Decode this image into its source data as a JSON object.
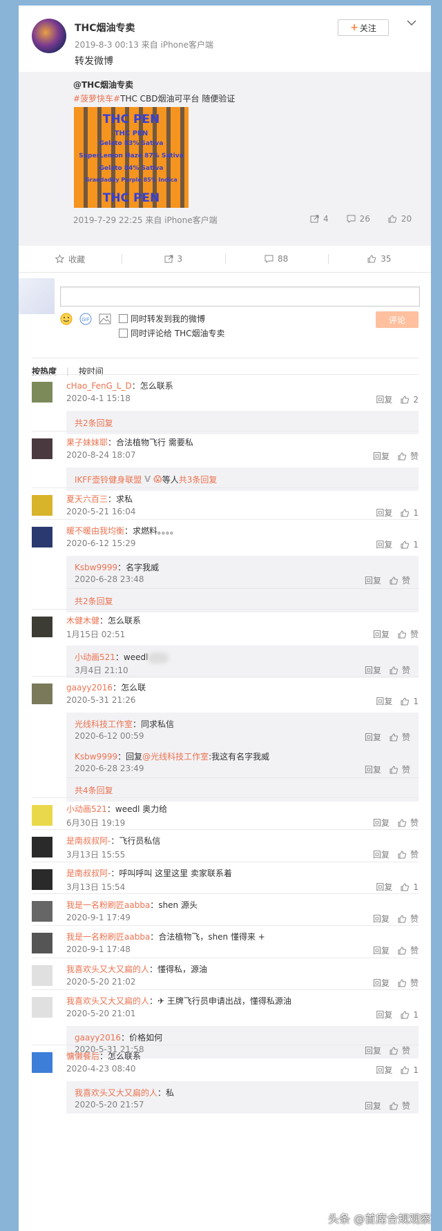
{
  "post": {
    "username": "THC烟油专卖",
    "follow_label": "关注",
    "meta": "2019-8-3 00:13 来自 iPhone客户端",
    "text": "转发微博"
  },
  "repost": {
    "user": "@THC烟油专卖",
    "tag": "#菠萝快车#",
    "text": "THC CBD烟油可平台 随便验证",
    "image_lines": [
      "THC PEN",
      "THC PEN",
      "Gelato 83% Sativa",
      "SuperLemon Haze 87% Sativa",
      "Gelato 84% Sativa",
      "Grandaddy Purple 85% Indica",
      "THC PEN"
    ],
    "meta": "2019-7-29 22:25 来自 iPhone客户端",
    "reposts": "4",
    "comments": "26",
    "likes": "20"
  },
  "actions": {
    "favorite": "收藏",
    "repost": "3",
    "comment": "88",
    "like": "35"
  },
  "composer": {
    "opt_repost": "同时转发到我的微博",
    "opt_comment": "同时评论给 THC烟油专卖",
    "submit": "评论"
  },
  "sort": {
    "hot": "按热度",
    "time": "按时间"
  },
  "labels": {
    "reply": "回复",
    "like": "赞"
  },
  "comments": [
    {
      "user": "cHao_FenG_L_D",
      "text": "怎么联系",
      "time": "2020-4-1 15:18",
      "likes": "2",
      "more": "共2条回复"
    },
    {
      "user": "果子妹妹耶",
      "text": "合法植物飞行 需要私",
      "time": "2020-8-24 18:07",
      "likes": "赞",
      "more_user": "IKFF壶铃健身联盟",
      "more_mid": " 等人 ",
      "more": "共3条回复"
    },
    {
      "user": "夏天六百三",
      "text": "求私",
      "time": "2020-5-21 16:04",
      "likes": "1"
    },
    {
      "user": "暖不暖由我均衡",
      "text": "求燃料。。。。",
      "time": "2020-6-12 15:29",
      "likes": "1",
      "replies": [
        {
          "user": "Ksbw9999",
          "text": "名字我威",
          "time": "2020-6-28 23:48"
        }
      ],
      "more": "共2条回复"
    },
    {
      "user": "木健木健",
      "text": "怎么联系",
      "time": "1月15日 02:51",
      "likes": "赞",
      "replies": [
        {
          "user": "小动画521",
          "text": "weedl",
          "time": "3月4日 21:10"
        }
      ]
    },
    {
      "user": "gaayy2016",
      "text": "怎么联",
      "time": "2020-5-31 21:26",
      "likes": "1",
      "replies": [
        {
          "user": "光线科技工作室",
          "text": "同求私信",
          "time": "2020-6-12 00:59"
        },
        {
          "user": "Ksbw9999",
          "text_pre": "回复",
          "mention": "@光线科技工作室",
          "text": ":我这有名字我威",
          "time": "2020-6-28 23:49"
        }
      ],
      "more": "共4条回复"
    },
    {
      "user": "小动画521",
      "text": "weedl            奥力给",
      "time": "6月30日 19:19",
      "likes": "赞"
    },
    {
      "user": "是南叔叔阿-",
      "text": "飞行员私信",
      "time": "3月13日 15:55",
      "likes": "赞"
    },
    {
      "user": "是南叔叔阿-",
      "text": "呼叫呼叫  这里这里  卖家联系着",
      "time": "3月13日 15:54",
      "likes": "1"
    },
    {
      "user": "我是一名粉刷匠aabba",
      "text": "shen        源头",
      "time": "2020-9-1 17:49",
      "likes": "赞"
    },
    {
      "user": "我是一名粉刷匠aabba",
      "text": "合法植物飞，shen           懂得来 +",
      "time": "2020-9-1 17:48",
      "likes": "赞"
    },
    {
      "user": "我喜欢头又大又扁的人",
      "text": "懂得私，源油",
      "time": "2020-5-20 21:02",
      "likes": "赞"
    },
    {
      "user": "我喜欢头又大又扁的人",
      "text": "✈ 王牌飞行员申请出战，懂得私源油",
      "time": "2020-5-20 21:01",
      "likes": "1",
      "replies": [
        {
          "user": "gaayy2016",
          "text": "价格如何",
          "time": "2020-5-31 21:58"
        }
      ]
    },
    {
      "user": "慵懒餐后",
      "text": "怎么联系",
      "time": "2020-4-23 08:40",
      "likes": "1",
      "replies": [
        {
          "user": "我喜欢头又大又扁的人",
          "text": "私",
          "time": "2020-5-20 21:57"
        }
      ]
    }
  ],
  "watermark": "头条 @首席合规观察",
  "colors": {
    "accent": "#eb7350",
    "page_bg": "#8ab3d8",
    "sub_bg": "#f2f2f5"
  }
}
